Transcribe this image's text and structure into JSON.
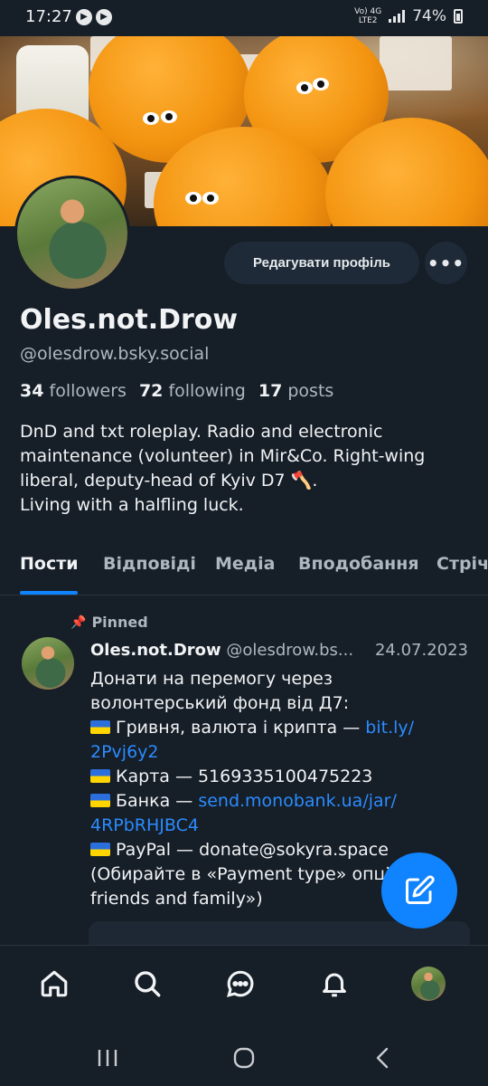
{
  "status_bar": {
    "time": "17:27",
    "network_top": "Vo) 4G",
    "network_bottom": "LTE2",
    "battery": "74%"
  },
  "profile": {
    "edit_button": "Редагувати профіль",
    "more_label": "•••",
    "display_name": "Oles.not.Drow",
    "handle": "@olesdrow.bsky.social",
    "followers_count": "34",
    "followers_label": "followers",
    "following_count": "72",
    "following_label": "following",
    "posts_count": "17",
    "posts_label": "posts",
    "bio_lines": [
      "DnD and txt roleplay. Radio and electronic",
      "maintenance (volunteer) in Mir&Co. Right-wing",
      "liberal, deputy-head of Kyiv D7 🪓.",
      "Living with a halfling luck."
    ]
  },
  "tabs": [
    "Пости",
    "Відповіді",
    "Медіа",
    "Вподобання",
    "Стрічки"
  ],
  "post": {
    "pinned_label": "Pinned",
    "author": "Oles.not.Drow",
    "handle": "@olesdrow.bs...",
    "date": "24.07.2023",
    "line1": "Донати на перемогу через",
    "line2": "волонтерський фонд від Д7:",
    "line3_text": "Гривня, валюта і крипта — ",
    "line3_link": "bit.ly/",
    "line4_link": "2Pvj6y2",
    "line5_text": "Карта — 5169335100475223",
    "line6_text": "Банка — ",
    "line6_link": "send.monobank.ua/jar/",
    "line7_link": "4RPbRHJBC4",
    "line8_text": "PayPal — donate@sokyra.space",
    "line9": "(Обирайте в «Payment type» опцію",
    "line10": "friends and family»)"
  },
  "colors": {
    "background": "#161e27",
    "accent": "#1083fe",
    "link": "#2b8cff",
    "muted_text": "#aeb6c0"
  },
  "icons": {
    "nav": [
      "home-icon",
      "search-icon",
      "chat-icon",
      "bell-icon",
      "profile-avatar"
    ],
    "fab": "compose-icon",
    "system": [
      "recents-icon",
      "home-circle-icon",
      "back-icon"
    ]
  }
}
